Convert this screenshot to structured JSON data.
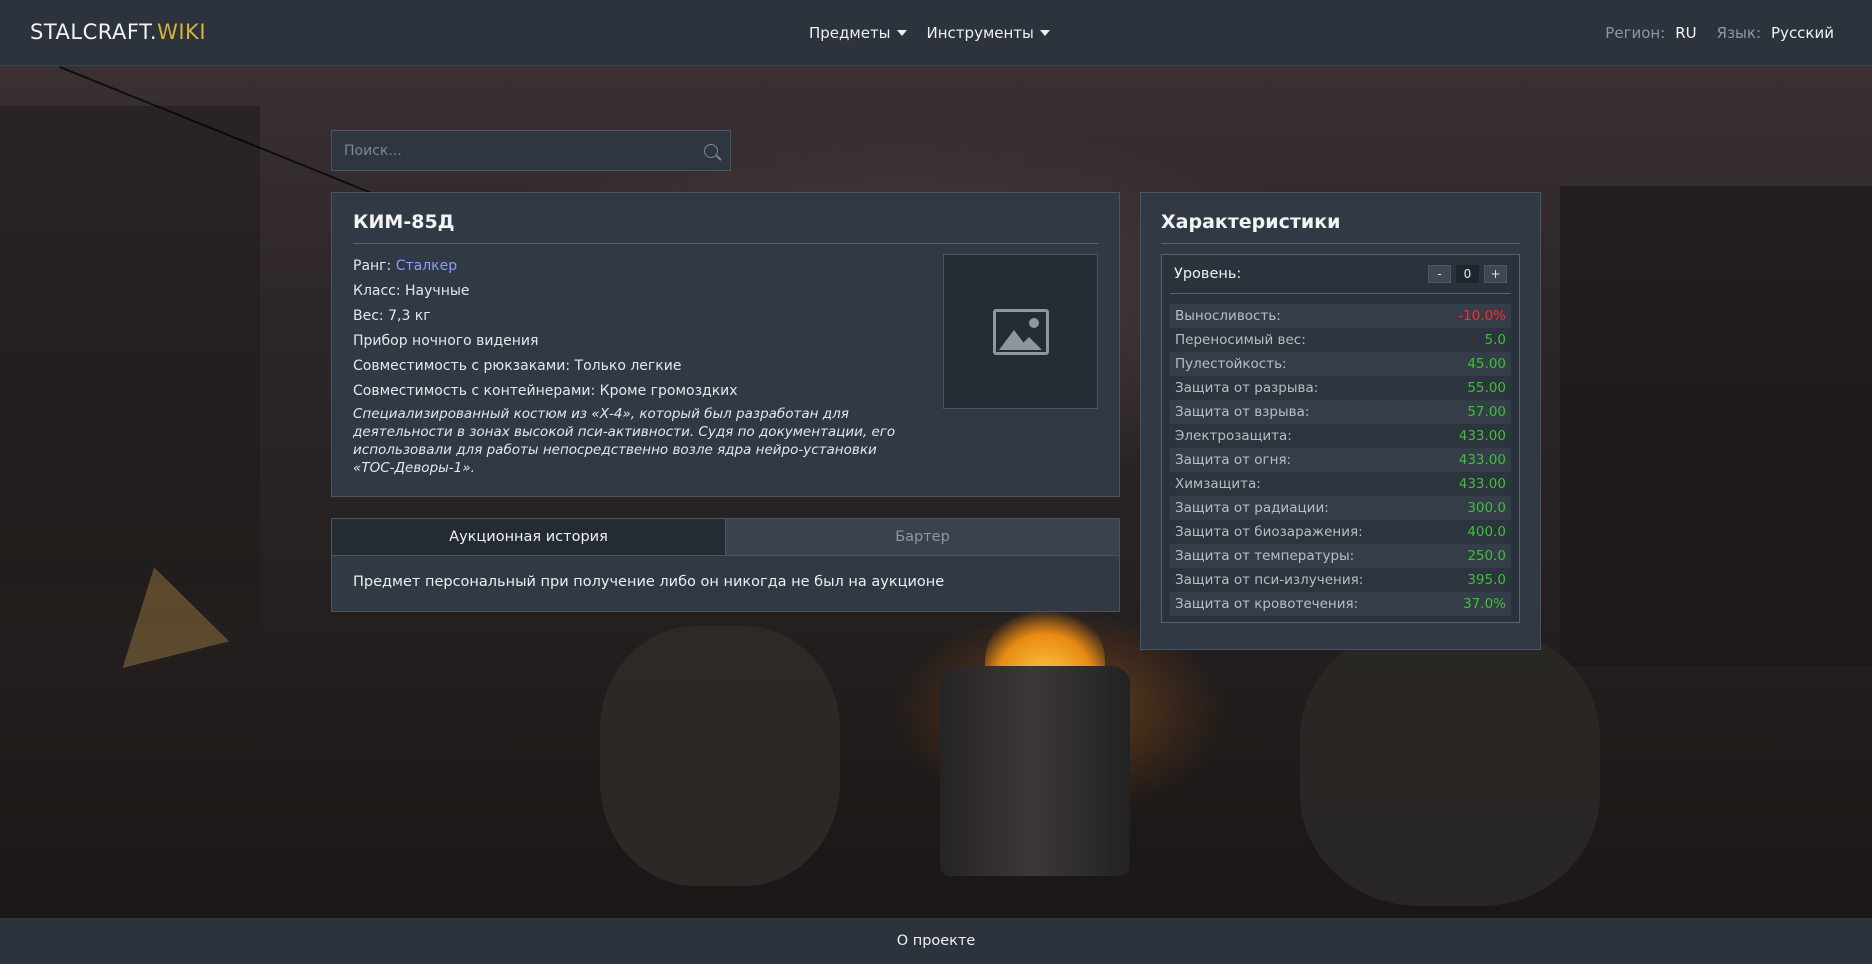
{
  "header": {
    "logo_main": "STALCRAFT.",
    "logo_accent": "WIKI",
    "nav": [
      {
        "label": "Предметы"
      },
      {
        "label": "Инструменты"
      }
    ],
    "region_label": "Регион:",
    "region_value": "RU",
    "language_label": "Язык:",
    "language_value": "Русский"
  },
  "search": {
    "placeholder": "Поиск..."
  },
  "item": {
    "title": "КИМ-85Д",
    "rank_label": "Ранг:",
    "rank_value": "Сталкер",
    "class": "Класс: Научные",
    "weight": "Вес: 7,3 кг",
    "feature": "Прибор ночного видения",
    "backpack_compat": "Совместимость с рюкзаками: Только легкие",
    "container_compat": "Совместимость с контейнерами: Кроме громоздких",
    "description": "Специализированный костюм из «Х-4», который был разработан для деятельности в зонах высокой пси-активности. Судя по документации, его использовали для работы непосредственно возле ядра нейро-установки «ТОС-Деворы-1»."
  },
  "tabs": {
    "auction": "Аукционная история",
    "barter": "Бартер",
    "content": "Предмет персональный при получение либо он никогда не был на аукционе"
  },
  "stats": {
    "title": "Характеристики",
    "level_label": "Уровень:",
    "minus": "-",
    "level_value": "0",
    "plus": "+",
    "rows": [
      {
        "name": "Выносливость:",
        "value": "-10.0%"
      },
      {
        "name": "Переносимый вес:",
        "value": "5.0"
      },
      {
        "name": "Пулестойкость:",
        "value": "45.00"
      },
      {
        "name": "Защита от разрыва:",
        "value": "55.00"
      },
      {
        "name": "Защита от взрыва:",
        "value": "57.00"
      },
      {
        "name": "Электрозащита:",
        "value": "433.00"
      },
      {
        "name": "Защита от огня:",
        "value": "433.00"
      },
      {
        "name": "Химзащита:",
        "value": "433.00"
      },
      {
        "name": "Защита от радиации:",
        "value": "300.0"
      },
      {
        "name": "Защита от биозаражения:",
        "value": "400.0"
      },
      {
        "name": "Защита от температуры:",
        "value": "250.0"
      },
      {
        "name": "Защита от пси-излучения:",
        "value": "395.0"
      },
      {
        "name": "Защита от кровотечения:",
        "value": "37.0%"
      }
    ],
    "positive_color": "#3fbf3a",
    "negative_color": "#ff2a2a"
  },
  "footer": {
    "about": "О проекте"
  }
}
